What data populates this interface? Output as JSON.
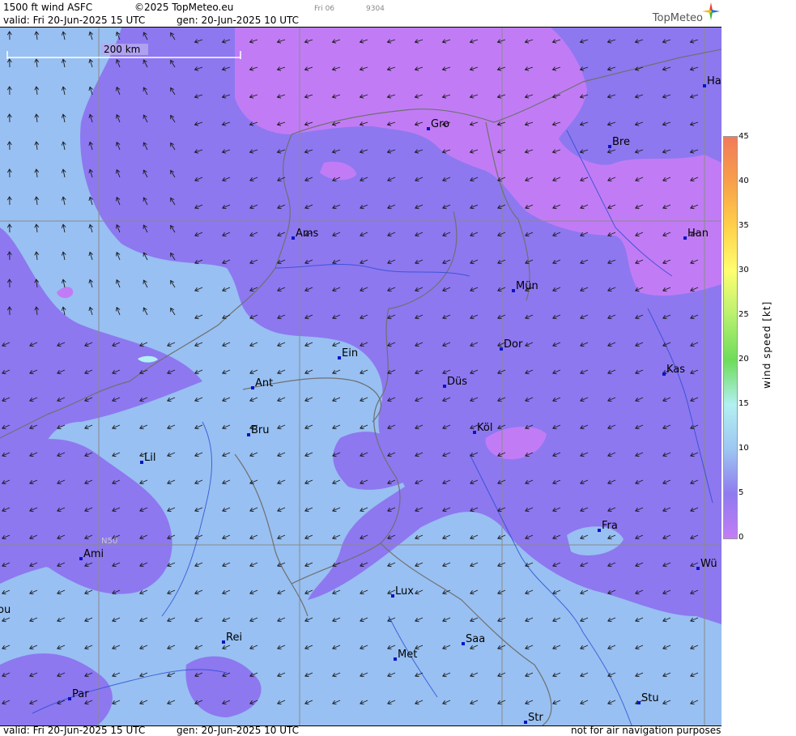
{
  "header": {
    "title": "1500 ft wind ASFC",
    "copyright": "©2025 TopMeteo.eu",
    "frame": "Fri 06",
    "code": "9304",
    "valid": "valid:  Fri  20-Jun-2025  15 UTC",
    "gen": "gen: 20-Jun-2025 10 UTC",
    "brand": "TopMeteo"
  },
  "footer": {
    "valid": "valid:  Fri  20-Jun-2025  15 UTC",
    "gen": "gen: 20-Jun-2025 10 UTC",
    "note": "not for air navigation purposes"
  },
  "scale_label": "200 km",
  "lat_label": "N50",
  "legend": {
    "label": "wind  speed  [kt]",
    "ticks": [
      "45",
      "40",
      "35",
      "30",
      "25",
      "20",
      "15",
      "10",
      "5",
      "0"
    ],
    "colors": [
      "#f27a5a",
      "#f7a04a",
      "#ffd04a",
      "#ffff70",
      "#b8f070",
      "#6edc5a",
      "#b2f0f2",
      "#9dc6f2",
      "#8f7af0",
      "#c37cf5"
    ]
  },
  "cities": [
    {
      "name": "Gro"
    },
    {
      "name": "Bre"
    },
    {
      "name": "Ha"
    },
    {
      "name": "Ams"
    },
    {
      "name": "Han"
    },
    {
      "name": "Mün"
    },
    {
      "name": "Dor"
    },
    {
      "name": "Ein"
    },
    {
      "name": "Kas"
    },
    {
      "name": "Ant"
    },
    {
      "name": "Düs"
    },
    {
      "name": "Bru"
    },
    {
      "name": "Köl"
    },
    {
      "name": "Lil"
    },
    {
      "name": "Fra"
    },
    {
      "name": "Ami"
    },
    {
      "name": "Wü"
    },
    {
      "name": "ou"
    },
    {
      "name": "Lux"
    },
    {
      "name": "Rei"
    },
    {
      "name": "Saa"
    },
    {
      "name": "Met"
    },
    {
      "name": "Par"
    },
    {
      "name": "Stu"
    },
    {
      "name": "Str"
    }
  ]
}
